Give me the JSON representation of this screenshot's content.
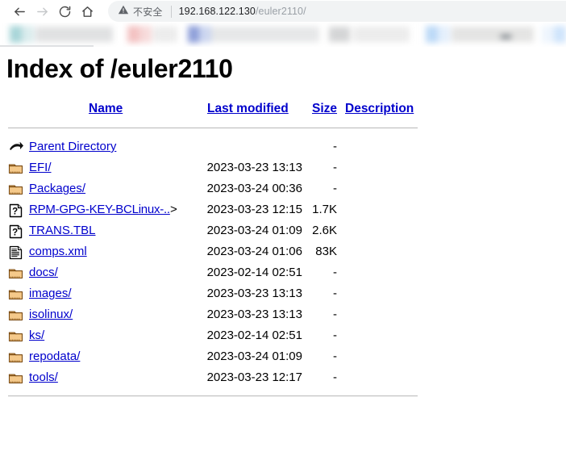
{
  "browser": {
    "nav": {
      "back_icon": "arrow-left-icon",
      "forward_icon": "arrow-right-icon",
      "reload_icon": "reload-icon",
      "home_icon": "home-icon"
    },
    "omnibox": {
      "security_icon": "warning-triangle-icon",
      "security_label": "不安全",
      "url_host": "192.168.122.130",
      "url_path": "/euler2110/",
      "url_full": "192.168.122.130/euler2110/"
    },
    "bookmark_bar": {
      "redacted": true,
      "note": "blurred bookmark entries",
      "favicon_colors": [
        "#a8d5d8",
        "#f3c2c2",
        "#8e9fd9",
        "#bcd9f7",
        "#cfe4fb"
      ]
    }
  },
  "page": {
    "title": "Index of /euler2110",
    "columns": {
      "name": "Name",
      "last_modified": "Last modified",
      "size": "Size",
      "description": "Description"
    },
    "rows": [
      {
        "icon": "back-arrow-icon",
        "name": "Parent Directory",
        "trunc": "",
        "modified": "",
        "size": "-",
        "description": ""
      },
      {
        "icon": "folder-icon",
        "name": "EFI/",
        "trunc": "",
        "modified": "2023-03-23 13:13",
        "size": "-",
        "description": ""
      },
      {
        "icon": "folder-icon",
        "name": "Packages/",
        "trunc": "",
        "modified": "2023-03-24 00:36",
        "size": "-",
        "description": ""
      },
      {
        "icon": "unknown-file-icon",
        "name": "RPM-GPG-KEY-BCLinux-..",
        "trunc": ">",
        "modified": "2023-03-23 12:15",
        "size": "1.7K",
        "description": ""
      },
      {
        "icon": "unknown-file-icon",
        "name": "TRANS.TBL",
        "trunc": "",
        "modified": "2023-03-24 01:09",
        "size": "2.6K",
        "description": ""
      },
      {
        "icon": "text-file-icon",
        "name": "comps.xml",
        "trunc": "",
        "modified": "2023-03-24 01:06",
        "size": "83K",
        "description": ""
      },
      {
        "icon": "folder-icon",
        "name": "docs/",
        "trunc": "",
        "modified": "2023-02-14 02:51",
        "size": "-",
        "description": ""
      },
      {
        "icon": "folder-icon",
        "name": "images/",
        "trunc": "",
        "modified": "2023-03-23 13:13",
        "size": "-",
        "description": ""
      },
      {
        "icon": "folder-icon",
        "name": "isolinux/",
        "trunc": "",
        "modified": "2023-03-23 13:13",
        "size": "-",
        "description": ""
      },
      {
        "icon": "folder-icon",
        "name": "ks/",
        "trunc": "",
        "modified": "2023-02-14 02:51",
        "size": "-",
        "description": ""
      },
      {
        "icon": "folder-icon",
        "name": "repodata/",
        "trunc": "",
        "modified": "2023-03-24 01:09",
        "size": "-",
        "description": ""
      },
      {
        "icon": "folder-icon",
        "name": "tools/",
        "trunc": "",
        "modified": "2023-03-23 12:17",
        "size": "-",
        "description": ""
      }
    ]
  },
  "colors": {
    "link": "#0000cc",
    "folder_fill": "#f5c98a",
    "folder_outline": "#7a4b13",
    "rule": "#b8b8b8",
    "omnibox_bg": "#f1f3f4"
  }
}
